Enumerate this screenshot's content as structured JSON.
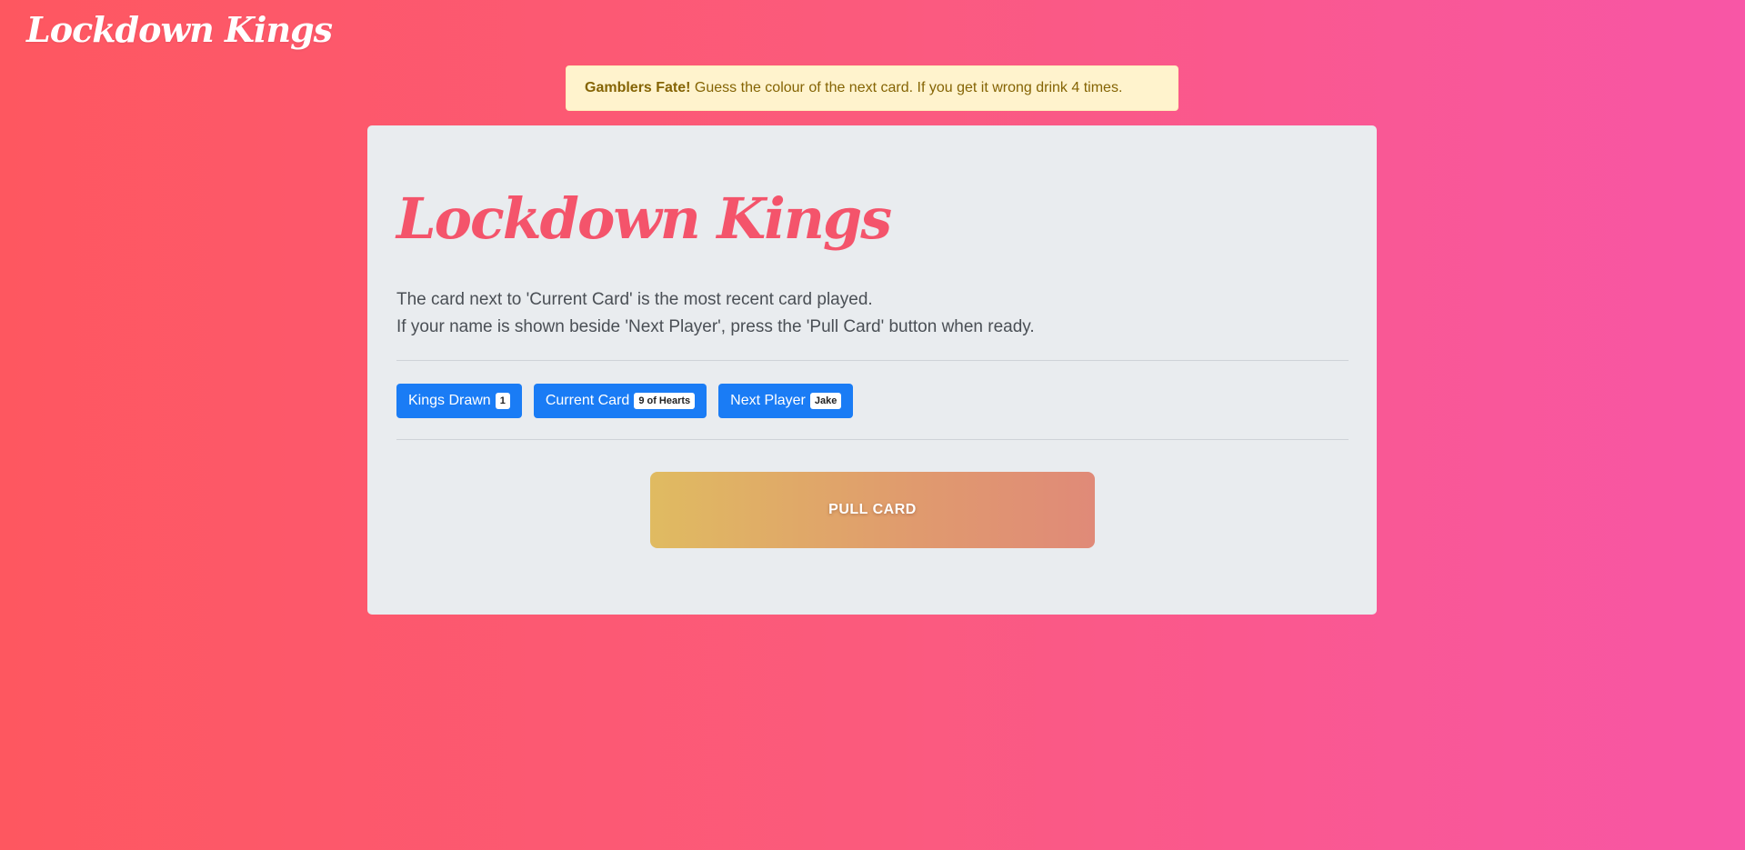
{
  "navbar": {
    "brand": "Lockdown Kings"
  },
  "alert": {
    "title": "Gamblers Fate!",
    "message": " Guess the colour of the next card. If you get it wrong drink 4 times."
  },
  "main": {
    "heading": "Lockdown Kings",
    "lead_line1": "The card next to 'Current Card' is the most recent card played.",
    "lead_line2": "If your name is shown beside 'Next Player', press the 'Pull Card' button when ready.",
    "status_buttons": [
      {
        "label": "Kings Drawn",
        "badge": "1"
      },
      {
        "label": "Current Card",
        "badge": "9 of Hearts"
      },
      {
        "label": "Next Player",
        "badge": "Jake"
      }
    ],
    "pull_card_label": "PULL CARD"
  },
  "colors": {
    "background_start": "#fe5760",
    "background_end": "#f856a6",
    "heading": "#f4546b",
    "button_primary": "#1a7cf5",
    "alert_bg": "#fff3cd",
    "alert_text": "#856404"
  }
}
